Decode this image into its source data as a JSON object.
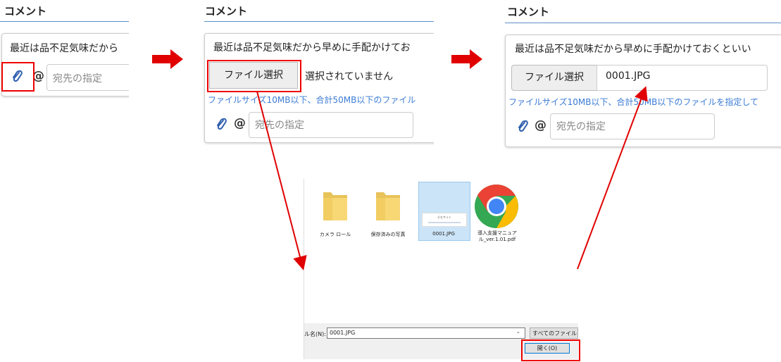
{
  "panel1": {
    "heading": "コメント",
    "comment_text": "最近は品不足気味だから",
    "recipient_placeholder": "宛先の指定",
    "at_symbol": "@"
  },
  "panel2": {
    "heading": "コメント",
    "comment_text": "最近は品不足気味だから早めに手配かけてお",
    "file_button": "ファイル選択",
    "file_status": "選択されていません",
    "note": "ファイルサイズ10MB以下、合計50MB以下のファイル",
    "recipient_placeholder": "宛先の指定",
    "at_symbol": "@"
  },
  "panel3": {
    "heading": "コメント",
    "comment_text": "最近は品不足気味だから早めに手配かけておくといい",
    "file_button": "ファイル選択",
    "file_name": "0001.JPG",
    "note": "ファイルサイズ10MB以下、合計50MB以下のファイルを指定して",
    "recipient_placeholder": "宛先の指定",
    "at_symbol": "@"
  },
  "dialog": {
    "items": [
      {
        "label": "カメラ ロール",
        "icon": "folder-icon"
      },
      {
        "label": "保存済みの写真",
        "icon": "folder-icon"
      },
      {
        "label": "0001.JPG",
        "icon": "image-thumbnail-icon",
        "thumb_text": "デモサイト"
      },
      {
        "label": "導入支援マニュア\nル_ver.1.01.pdf",
        "icon": "chrome-icon"
      }
    ],
    "filename_label": "ル名(N):",
    "filename_value": "0001.JPG",
    "filetype_value": "すべてのファイル (*.*",
    "open_button": "開く(O)"
  },
  "colors": {
    "annotation_red": "#e00000",
    "link_blue": "#3a7bd5",
    "heading_line": "#5b8fc9"
  }
}
